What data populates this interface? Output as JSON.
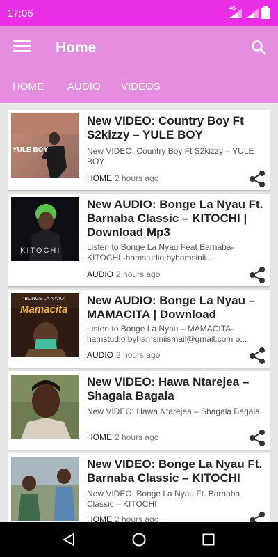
{
  "status_bar": {
    "time": "17:06",
    "network": "4G"
  },
  "app_bar": {
    "title": "Home"
  },
  "tabs": [
    {
      "label": "HOME"
    },
    {
      "label": "AUDIO"
    },
    {
      "label": "VIDEOS"
    }
  ],
  "posts": [
    {
      "title": "New VIDEO: Country Boy Ft S2kizzy – YULE BOY",
      "excerpt": "New VIDEO: Country Boy Ft S2kizzy – YULE BOY",
      "category": "HOME",
      "time": "2 hours ago",
      "thumb_text": "YULE BOY"
    },
    {
      "title": "New AUDIO: Bonge La Nyau Ft. Barnaba Classic – KITOCHI | Download Mp3",
      "excerpt": "Listen to Bonge La Nyau Feat Barnaba- KITOCHI -hamstudio byhamsinii...",
      "category": "AUDIO",
      "time": "2 hours ago",
      "thumb_text": "KITOCHI"
    },
    {
      "title": "New AUDIO: Bonge La Nyau – MAMACITA | Download",
      "excerpt": "Listen to Bonge La Nyau – MAMACITA-hamstudio byhamsiniismail@gmail.com o...",
      "category": "AUDIO",
      "time": "2 hours ago",
      "thumb_text": "Mamacita",
      "thumb_caption": "\"BONGE LA NYAU\""
    },
    {
      "title": "New VIDEO: Hawa Ntarejea – Shagala Bagala",
      "excerpt": "New VIDEO: Hawa Ntarejea – Shagala Bagala",
      "category": "HOME",
      "time": "2 hours ago"
    },
    {
      "title": "New VIDEO: Bonge La Nyau Ft. Barnaba Classic – KITOCHI",
      "excerpt": "New VIDEO: Bonge La Nyau Ft. Barnaba Classic – KITOCHI",
      "category": "HOME",
      "time": "2 hours ago"
    }
  ],
  "colors": {
    "status_bar": "#ea2fe6",
    "app_bar": "#e58ee0",
    "background": "#e6e6e6"
  }
}
